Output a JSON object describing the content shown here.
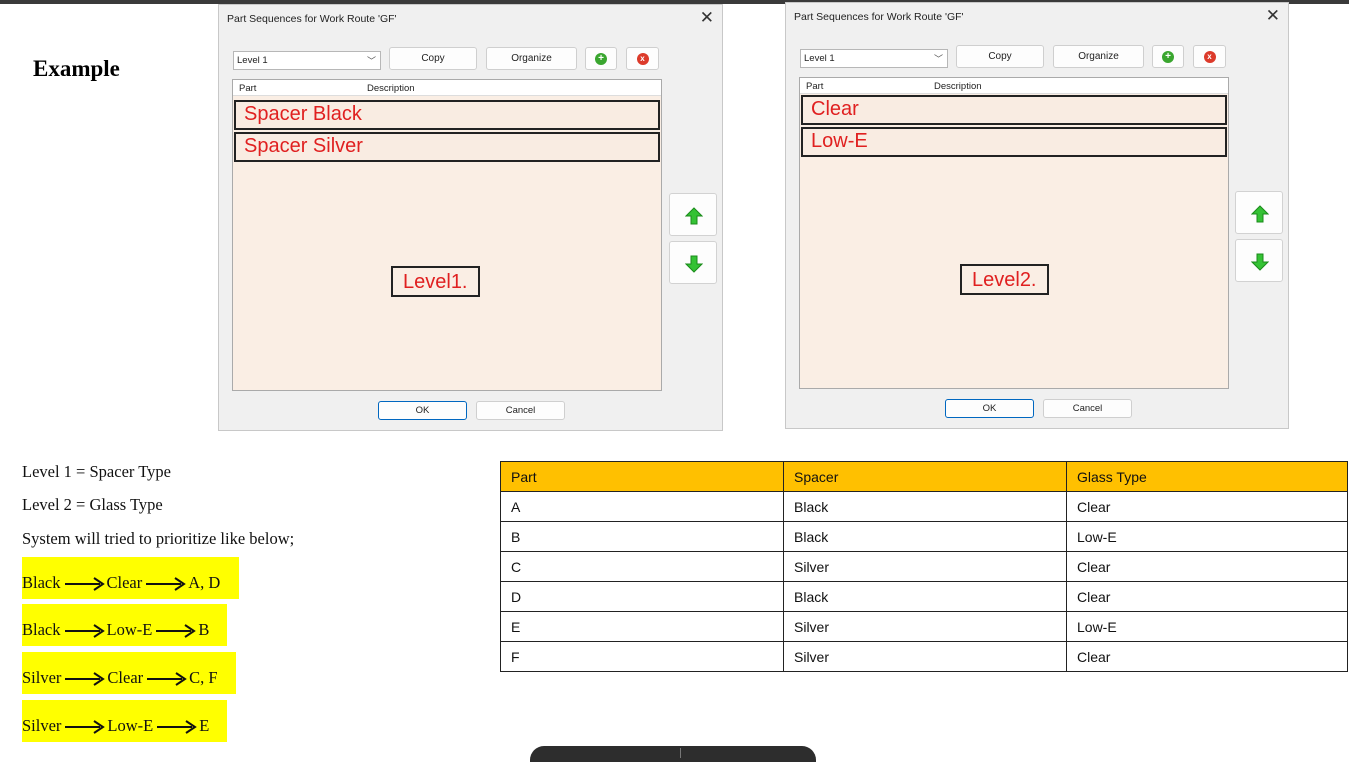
{
  "heading": "Example",
  "dialogs": [
    {
      "title": "Part Sequences for Work Route 'GF'",
      "level_select": "Level 1",
      "copy_label": "Copy",
      "organize_label": "Organize",
      "add_icon": "+",
      "delete_icon": "x",
      "col_part": "Part",
      "col_description": "Description",
      "rows": [
        "Spacer Black",
        "Spacer Silver"
      ],
      "level_tag": "Level1.",
      "ok_label": "OK",
      "cancel_label": "Cancel"
    },
    {
      "title": "Part Sequences for Work Route 'GF'",
      "level_select": "Level 1",
      "copy_label": "Copy",
      "organize_label": "Organize",
      "add_icon": "+",
      "delete_icon": "x",
      "col_part": "Part",
      "col_description": "Description",
      "rows": [
        "Clear",
        "Low-E"
      ],
      "level_tag": "Level2.",
      "ok_label": "OK",
      "cancel_label": "Cancel"
    }
  ],
  "notes": {
    "level1": "Level 1 = Spacer Type",
    "level2": "Level 2 = Glass Type",
    "system": "System will tried to prioritize like below;"
  },
  "priorities": [
    {
      "spacer": "Black",
      "glass": "Clear",
      "parts": "A, D"
    },
    {
      "spacer": "Black",
      "glass": "Low-E",
      "parts": "B"
    },
    {
      "spacer": "Silver",
      "glass": "Clear",
      "parts": "C, F"
    },
    {
      "spacer": "Silver",
      "glass": "Low-E",
      "parts": "E"
    }
  ],
  "table": {
    "headers": [
      "Part",
      "Spacer",
      "Glass Type"
    ],
    "rows": [
      [
        "A",
        "Black",
        "Clear"
      ],
      [
        "B",
        "Black",
        "Low-E"
      ],
      [
        "C",
        "Silver",
        "Clear"
      ],
      [
        "D",
        "Black",
        "Clear"
      ],
      [
        "E",
        "Silver",
        "Low-E"
      ],
      [
        "F",
        "Silver",
        "Clear"
      ]
    ]
  },
  "colors": {
    "header_fill": "#ffc000",
    "highlight": "#ffff00",
    "row_text": "#e02020",
    "list_bg": "#faeee4"
  }
}
